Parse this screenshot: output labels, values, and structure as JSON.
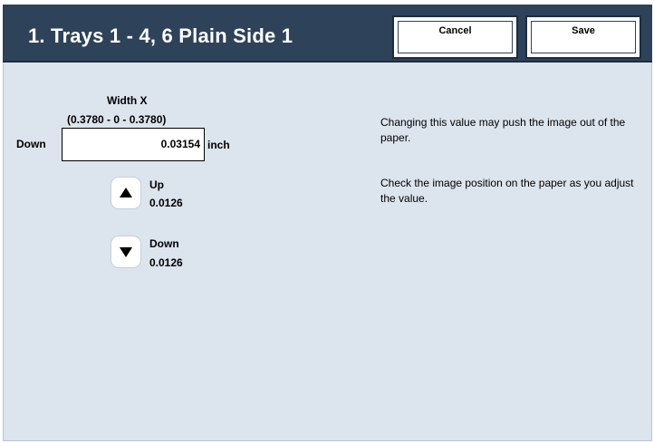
{
  "header": {
    "title": "1. Trays 1 - 4, 6   Plain  Side 1",
    "cancel_label": "Cancel",
    "save_label": "Save"
  },
  "adjust": {
    "field_title": "Width X",
    "range": "(0.3780 - 0 -  0.3780)",
    "direction_label": "Down",
    "value": "0.03154",
    "unit": "inch",
    "up_label": "Up",
    "up_step": "0.0126",
    "down_label": "Down",
    "down_step": "0.0126"
  },
  "messages": {
    "line1": "Changing this value may push the image out of the paper.",
    "line2": "Check the image position on the paper as you adjust the value."
  },
  "colors": {
    "header_bg": "#2e4259",
    "panel_bg": "#dce4ee"
  },
  "icons": {
    "up": "triangle-up-icon",
    "down": "triangle-down-icon"
  }
}
